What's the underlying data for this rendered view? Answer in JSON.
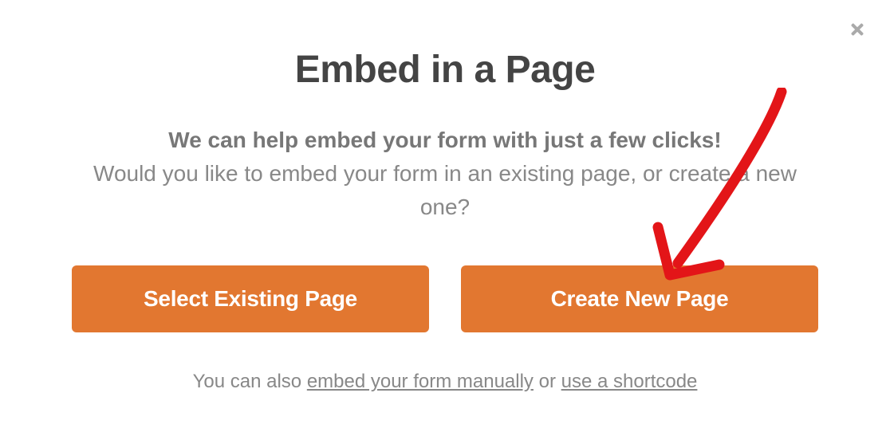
{
  "dialog": {
    "title": "Embed in a Page",
    "subtitle_bold": "We can help embed your form with just a few clicks!",
    "subtitle_rest": "Would you like to embed your form in an existing page, or create a new one?",
    "buttons": {
      "select_existing": "Select Existing Page",
      "create_new": "Create New Page"
    },
    "footer": {
      "prefix": "You can also ",
      "manual_link": "embed your form manually",
      "middle": " or ",
      "shortcode_link": "use a shortcode"
    }
  }
}
